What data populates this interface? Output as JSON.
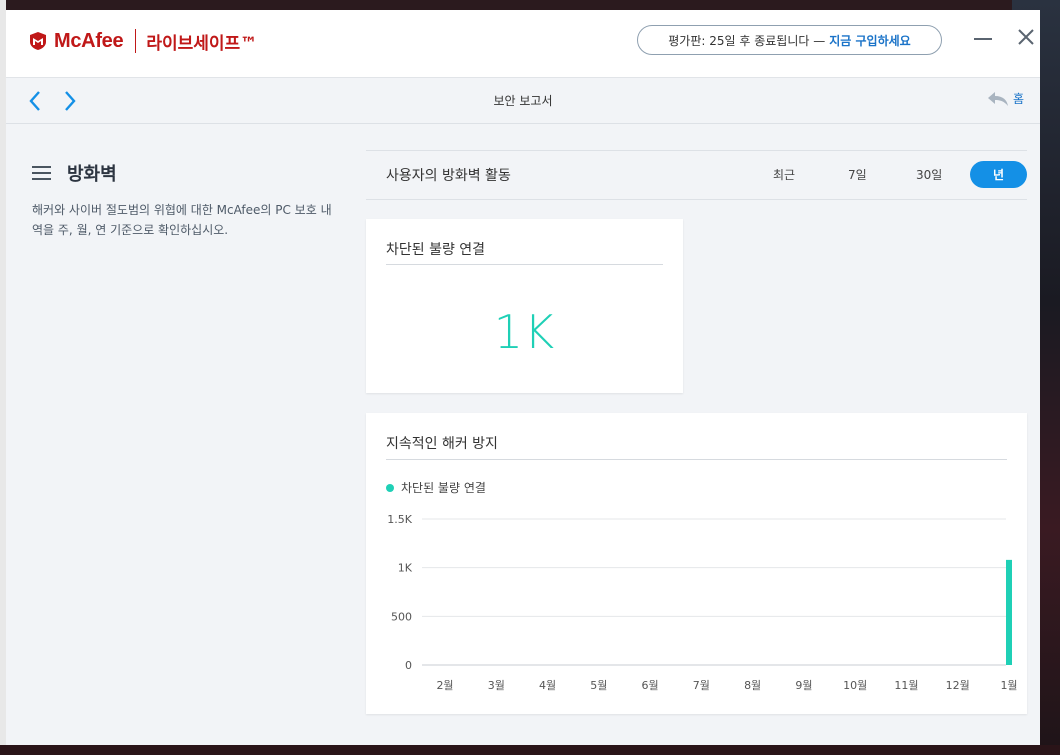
{
  "brand": {
    "name": "McAfee",
    "product": "라이브세이프™"
  },
  "trial": {
    "text": "평가판: 25일 후 종료됩니다 —",
    "link": "지금 구입하세요"
  },
  "nav": {
    "title": "보안 보고서",
    "home_label": "홈"
  },
  "sidebar": {
    "title": "방화벽",
    "description": "해커와 사이버 절도범의 위협에 대한 McAfee의 PC 보호 내역을 주, 월, 연 기준으로 확인하십시오."
  },
  "period": {
    "label": "사용자의 방화벽 활동",
    "options": [
      "최근",
      "7일",
      "30일",
      "년"
    ],
    "selected": "년"
  },
  "summary_card": {
    "title": "차단된 불량 연결",
    "value": "1K"
  },
  "chart_card": {
    "title": "지속적인 해커 방지",
    "legend": "차단된 불량 연결"
  },
  "colors": {
    "accent": "#1490e6",
    "series": "#1fd0b6",
    "brand": "#c01818"
  },
  "chart_data": {
    "type": "bar",
    "categories": [
      "2월",
      "3월",
      "4월",
      "5월",
      "6월",
      "7월",
      "8월",
      "9월",
      "10월",
      "11월",
      "12월",
      "1월"
    ],
    "series": [
      {
        "name": "차단된 불량 연결",
        "values": [
          0,
          0,
          0,
          0,
          0,
          0,
          0,
          0,
          0,
          0,
          0,
          1080
        ]
      }
    ],
    "yticks": [
      "0",
      "500",
      "1K",
      "1.5K"
    ],
    "ylim": [
      0,
      1500
    ],
    "grid": true,
    "legend": "top-left"
  }
}
